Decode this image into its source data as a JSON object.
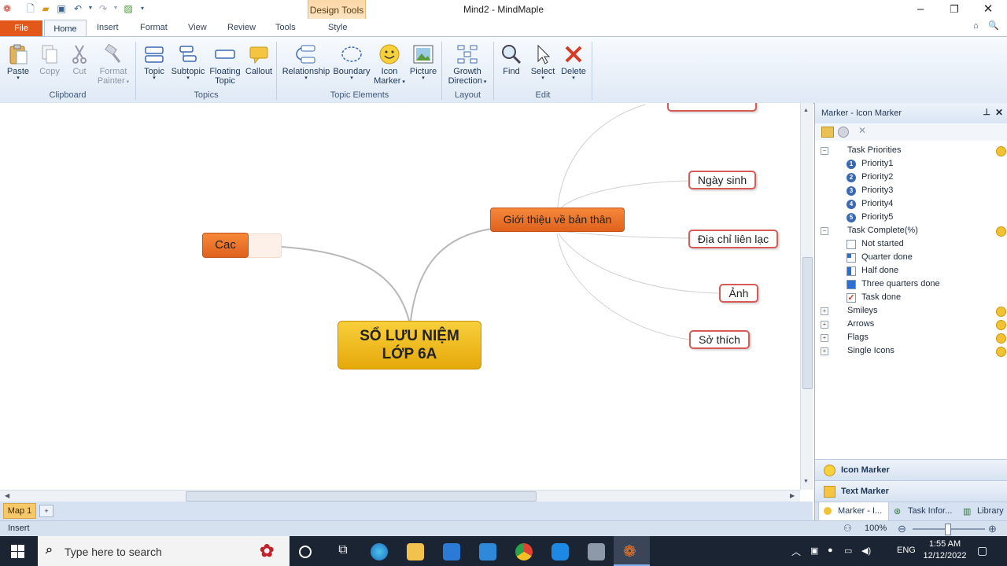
{
  "window": {
    "title": "Mind2 - MindMaple",
    "contextual_tab_group": "Design Tools",
    "controls": {
      "minimize": "✕",
      "restore": "❐",
      "close": "✕"
    }
  },
  "tabs": {
    "file": "File",
    "items": [
      "Home",
      "Insert",
      "Format",
      "View",
      "Review",
      "Tools"
    ],
    "contextual": "Style"
  },
  "ribbon": {
    "clipboard": {
      "label": "Clipboard",
      "paste": "Paste",
      "copy": "Copy",
      "cut": "Cut",
      "format_painter_1": "Format",
      "format_painter_2": "Painter"
    },
    "topics": {
      "label": "Topics",
      "topic": "Topic",
      "subtopic": "Subtopic",
      "floating_1": "Floating",
      "floating_2": "Topic",
      "callout": "Callout"
    },
    "topic_elements": {
      "label": "Topic Elements",
      "relationship": "Relationship",
      "boundary": "Boundary",
      "icon_marker_1": "Icon",
      "icon_marker_2": "Marker",
      "picture": "Picture"
    },
    "layout": {
      "label": "Layout",
      "growth_1": "Growth",
      "growth_2": "Direction"
    },
    "edit": {
      "label": "Edit",
      "find": "Find",
      "select": "Select",
      "delete": "Delete"
    }
  },
  "mindmap": {
    "central_line1": "SỔ LƯU NIỆM",
    "central_line2": "LỚP 6A",
    "left_topic": "Cac",
    "main_topic": "Giới thiệu về bản thân",
    "subtopics": {
      "birthday": "Ngày sinh",
      "address": "Địa chỉ liên lạc",
      "photo": "Ảnh",
      "hobby": "Sở thích"
    }
  },
  "sheet": {
    "tab": "Map 1"
  },
  "status": {
    "mode": "Insert",
    "zoom": "100%"
  },
  "panel": {
    "title": "Marker - Icon Marker",
    "categories": {
      "priorities": "Task Priorities",
      "complete": "Task Complete(%)",
      "smileys": "Smileys",
      "arrows": "Arrows",
      "flags": "Flags",
      "single": "Single Icons"
    },
    "priorities": [
      "Priority1",
      "Priority2",
      "Priority3",
      "Priority4",
      "Priority5"
    ],
    "priority_numbers": [
      "1",
      "2",
      "3",
      "4",
      "5"
    ],
    "complete_items": [
      "Not started",
      "Quarter done",
      "Half done",
      "Three quarters done",
      "Task done"
    ],
    "bottom_bars": {
      "icon_marker": "Icon Marker",
      "text_marker": "Text Marker"
    },
    "bottom_tabs": {
      "marker": "Marker - I...",
      "task": "Task Infor...",
      "library": "Library"
    }
  },
  "taskbar": {
    "search_placeholder": "Type here to search",
    "language": "ENG",
    "time": "1:55 AM",
    "date": "12/12/2022"
  },
  "colors": {
    "file_tab": "#e4571a",
    "central_topic": "#f2b71a",
    "main_topic": "#f07a2d",
    "subtopic_border": "#d65a55",
    "accent": "#3a69b4"
  }
}
